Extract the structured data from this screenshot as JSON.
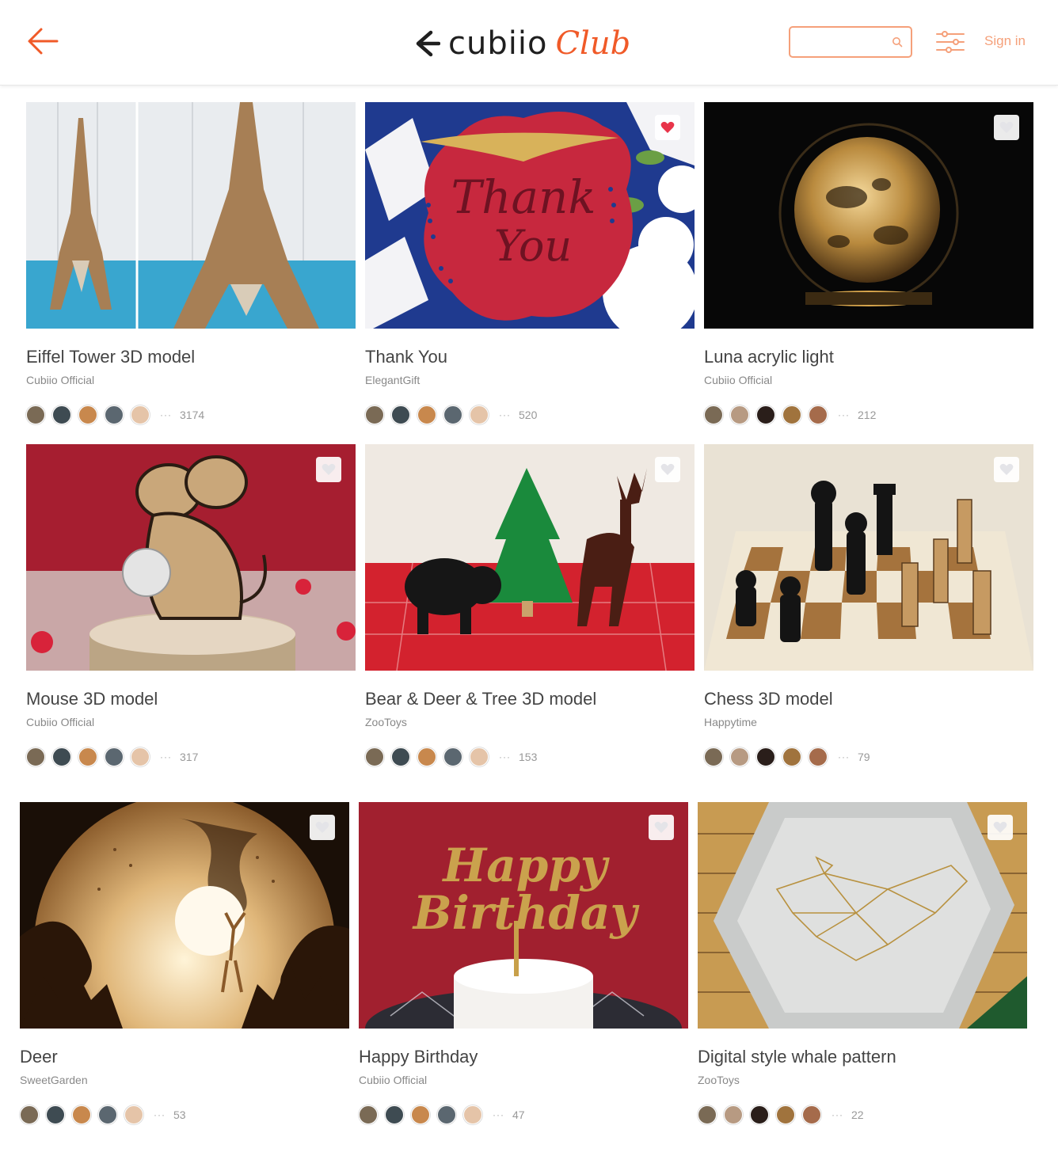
{
  "header": {
    "back_icon": "arrow-left-icon",
    "logo_word": "cubiio",
    "logo_club": "Club",
    "search_value": "",
    "search_icon": "search-icon",
    "filter_icon": "sliders-icon",
    "signin_label": "Sign in",
    "accent_color": "#f05a28"
  },
  "cards": [
    {
      "title": "Eiffel Tower 3D model",
      "author": "Cubiio Official",
      "count": "3174",
      "favorited": false
    },
    {
      "title": "Thank You",
      "author": "ElegantGift",
      "count": "520",
      "favorited": true
    },
    {
      "title": "Luna acrylic light",
      "author": "Cubiio Official",
      "count": "212",
      "favorited": false
    },
    {
      "title": "Mouse 3D model",
      "author": "Cubiio Official",
      "count": "317",
      "favorited": false
    },
    {
      "title": "Bear & Deer & Tree 3D model",
      "author": "ZooToys",
      "count": "153",
      "favorited": false
    },
    {
      "title": "Chess 3D model",
      "author": "Happytime",
      "count": "79",
      "favorited": false
    },
    {
      "title": "Deer",
      "author": "SweetGarden",
      "count": "53",
      "favorited": false
    },
    {
      "title": "Happy Birthday",
      "author": "Cubiio Official",
      "count": "47",
      "favorited": false
    },
    {
      "title": "Digital style whale pattern",
      "author": "ZooToys",
      "count": "22",
      "favorited": false
    }
  ],
  "thumbnail_text": {
    "thank_you": [
      "Thank",
      "You"
    ],
    "happy_birthday": [
      "Happy",
      "Birthday"
    ]
  },
  "likers_dots": "···"
}
